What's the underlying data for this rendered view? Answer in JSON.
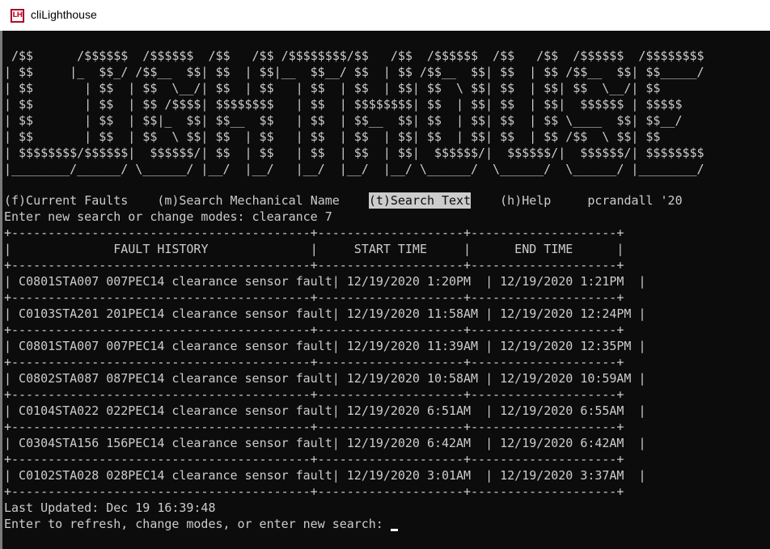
{
  "window": {
    "title": "cliLighthouse",
    "icon_text": "LH"
  },
  "banner": {
    "lines": [
      " /$$      /$$$$$$  /$$$$$$  /$$   /$$ /$$$$$$$$/$$   /$$  /$$$$$$  /$$   /$$  /$$$$$$  /$$$$$$$$",
      "| $$     |_  $$_/ /$$__  $$| $$  | $$|__  $$__/ $$  | $$ /$$__  $$| $$  | $$ /$$__  $$| $$_____/",
      "| $$       | $$  | $$  \\__/| $$  | $$   | $$  | $$  | $$| $$  \\ $$| $$  | $$| $$  \\__/| $$",
      "| $$       | $$  | $$ /$$$$| $$$$$$$$   | $$  | $$$$$$$$| $$  | $$| $$  | $$|  $$$$$$ | $$$$$",
      "| $$       | $$  | $$|_  $$| $$__  $$   | $$  | $$__  $$| $$  | $$| $$  | $$ \\____  $$| $$__/",
      "| $$       | $$  | $$  \\ $$| $$  | $$   | $$  | $$  | $$| $$  | $$| $$  | $$ /$$  \\ $$| $$",
      "| $$$$$$$$/$$$$$$|  $$$$$$/| $$  | $$   | $$  | $$  | $$|  $$$$$$/|  $$$$$$/|  $$$$$$/| $$$$$$$$",
      "|________/______/ \\______/ |__/  |__/   |__/  |__/  |__/ \\______/  \\______/  \\______/ |________/"
    ]
  },
  "menu": {
    "items": [
      {
        "label": "(f)Current Faults",
        "selected": false
      },
      {
        "label": "(m)Search Mechanical Name",
        "selected": false
      },
      {
        "label": "(t)Search Text",
        "selected": true
      },
      {
        "label": "(h)Help",
        "selected": false
      }
    ],
    "credit": "pcrandall '20"
  },
  "search_prompt": {
    "label": "Enter new search or change modes: ",
    "value": "clearance 7"
  },
  "table": {
    "border": "+-----------------------------------------+--------------------+--------------------+",
    "headers": [
      "FAULT HISTORY",
      "START TIME",
      "END TIME"
    ],
    "rows": [
      {
        "fault": "C0801STA007 007PEC14 clearance sensor fault",
        "start": "12/19/2020 1:20PM",
        "end": "12/19/2020 1:21PM"
      },
      {
        "fault": "C0103STA201 201PEC14 clearance sensor fault",
        "start": "12/19/2020 11:58AM",
        "end": "12/19/2020 12:24PM"
      },
      {
        "fault": "C0801STA007 007PEC14 clearance sensor fault",
        "start": "12/19/2020 11:39AM",
        "end": "12/19/2020 12:35PM"
      },
      {
        "fault": "C0802STA087 087PEC14 clearance sensor fault",
        "start": "12/19/2020 10:58AM",
        "end": "12/19/2020 10:59AM"
      },
      {
        "fault": "C0104STA022 022PEC14 clearance sensor fault",
        "start": "12/19/2020 6:51AM",
        "end": "12/19/2020 6:55AM"
      },
      {
        "fault": "C0304STA156 156PEC14 clearance sensor fault",
        "start": "12/19/2020 6:42AM",
        "end": "12/19/2020 6:42AM"
      },
      {
        "fault": "C0102STA028 028PEC14 clearance sensor fault",
        "start": "12/19/2020 3:01AM",
        "end": "12/19/2020 3:37AM"
      }
    ]
  },
  "status": {
    "last_updated": "Last Updated: Dec 19 16:39:48"
  },
  "input_prompt": {
    "label": "Enter to refresh, change modes, or enter new search:",
    "value": ""
  },
  "colors": {
    "console_bg": "#0c0c0c",
    "console_fg": "#cccccc",
    "selection_bg": "#cccccc",
    "titlebar_bg": "#ffffff"
  }
}
